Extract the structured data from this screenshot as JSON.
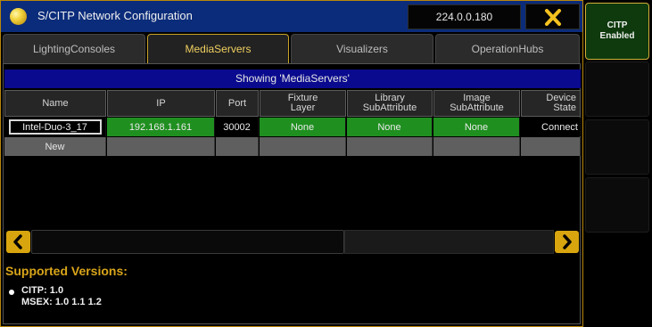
{
  "window": {
    "title": "S/CITP Network Configuration",
    "ip_address": "224.0.0.180"
  },
  "tabs": [
    {
      "label": "LightingConsoles",
      "active": false
    },
    {
      "label": "MediaServers",
      "active": true
    },
    {
      "label": "Visualizers",
      "active": false
    },
    {
      "label": "OperationHubs",
      "active": false
    }
  ],
  "showing_text": "Showing 'MediaServers'",
  "table": {
    "headers": {
      "name": "Name",
      "ip": "IP",
      "port": "Port",
      "fixture_layer": "Fixture Layer",
      "library_subattribute": "Library SubAttribute",
      "image_subattribute": "Image SubAttribute",
      "device_state": "Device State"
    },
    "rows": [
      {
        "name": "Intel-Duo-3_17",
        "ip": "192.168.1.161",
        "port": "30002",
        "fixture_layer": "None",
        "library_subattribute": "None",
        "image_subattribute": "None",
        "device_state": "Connect"
      }
    ],
    "new_label": "New"
  },
  "versions": {
    "title": "Supported Versions:",
    "citp": "CITP: 1.0",
    "msex": "MSEX: 1.0 1.1 1.2"
  },
  "side_panel": {
    "citp_line1": "CITP",
    "citp_line2": "Enabled"
  },
  "colors": {
    "title_bar": "#0b2c7a",
    "accent_gold": "#d9a51a",
    "active_green": "#1f8f1f",
    "showing_bar": "#0a0a8e"
  },
  "icons": {
    "title": "yellow-orb-icon",
    "close": "close-x-icon",
    "scroll_left": "chevron-left-icon",
    "scroll_right": "chevron-right-icon",
    "bullet": "bullet-icon"
  }
}
